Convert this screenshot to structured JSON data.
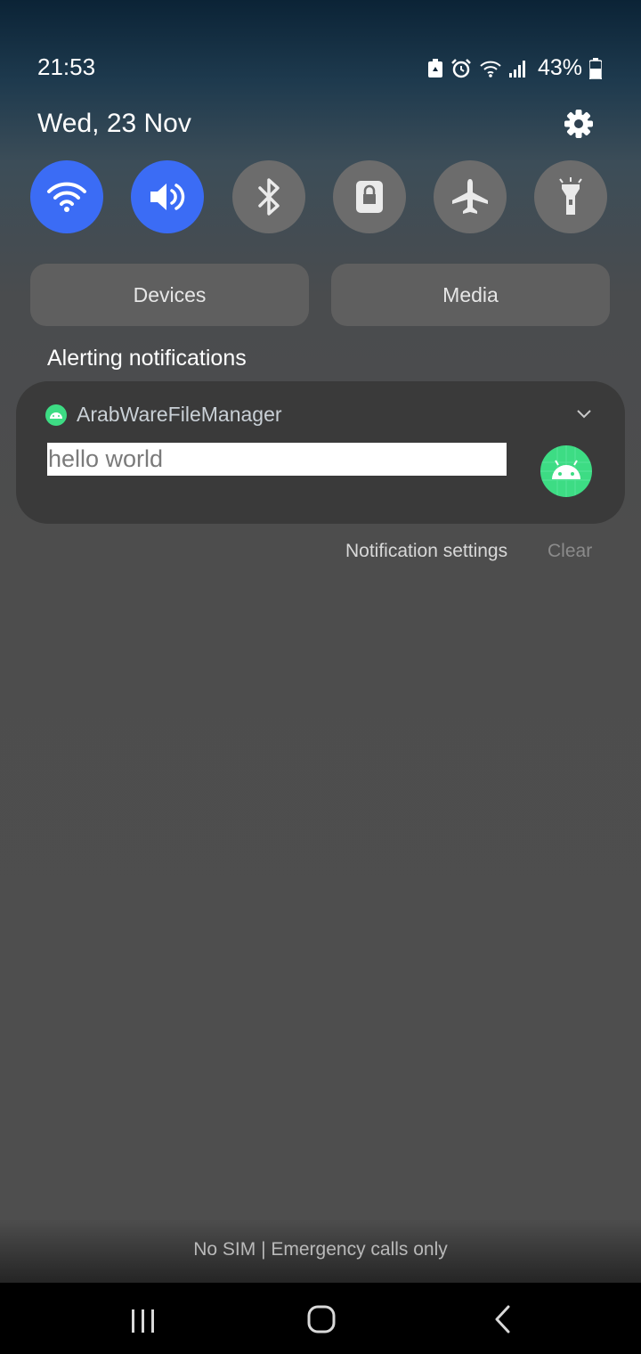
{
  "status_bar": {
    "time": "21:53",
    "battery_percent": "43%",
    "icons": [
      "battery-saver-icon",
      "alarm-icon",
      "wifi-icon",
      "signal-icon",
      "battery-icon"
    ]
  },
  "header": {
    "date": "Wed, 23 Nov",
    "settings_icon": "gear-icon"
  },
  "quick_settings": [
    {
      "name": "Wi-Fi",
      "icon": "wifi-icon",
      "state": "on"
    },
    {
      "name": "Sound",
      "icon": "volume-icon",
      "state": "on"
    },
    {
      "name": "Bluetooth",
      "icon": "bluetooth-icon",
      "state": "off"
    },
    {
      "name": "Portrait lock",
      "icon": "lock-icon",
      "state": "off"
    },
    {
      "name": "Airplane mode",
      "icon": "airplane-icon",
      "state": "off"
    },
    {
      "name": "Flashlight",
      "icon": "flashlight-icon",
      "state": "off"
    }
  ],
  "buttons": {
    "devices": "Devices",
    "media": "Media"
  },
  "notifications": {
    "section_title": "Alerting notifications",
    "items": [
      {
        "app_name": "ArabWareFileManager",
        "message": "hello world",
        "icon": "android-icon"
      }
    ],
    "settings_label": "Notification settings",
    "clear_label": "Clear"
  },
  "footer": {
    "carrier_text": "No SIM | Emergency calls only"
  },
  "colors": {
    "accent_on": "#3b6cf5",
    "toggle_off": "#6c6c6c",
    "android_green": "#3ddc84"
  }
}
